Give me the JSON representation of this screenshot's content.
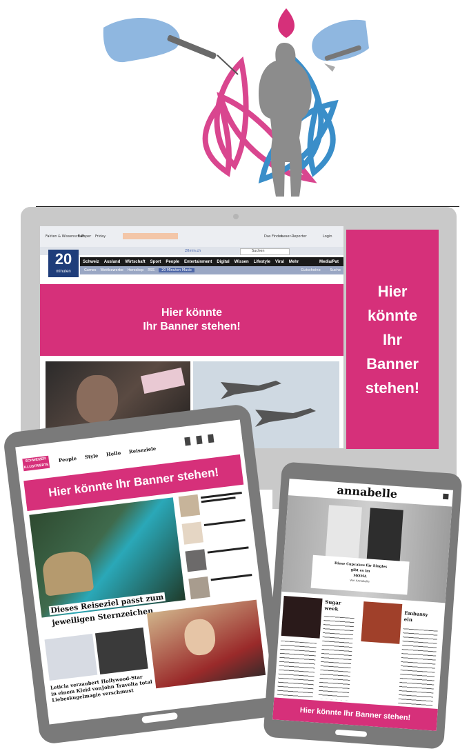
{
  "colors": {
    "accent": "#d6307a",
    "device_frame": "#7a7a7a",
    "monitor_frame": "#c9c9c9",
    "glove": "#8fb7e0",
    "lotus_pink": "#d9468f",
    "lotus_blue": "#3a8ec9",
    "silhouette": "#8c8c8c"
  },
  "monitor": {
    "site_logo": "20",
    "site_logo_sub": "minuten",
    "toplinks": [
      "Fakten & Wissenschaft",
      "E-Paper",
      "Friday"
    ],
    "toplinks_right": [
      "Das Finden",
      "Leser-Reporter",
      "Login"
    ],
    "url": "20min.ch",
    "search_placeholder": "Suchen",
    "nav_items": [
      "Schweiz",
      "Ausland",
      "Wirtschaft",
      "Sport",
      "People",
      "Entertainment",
      "Digital",
      "Wissen",
      "Lifestyle",
      "Viral",
      "Mehr"
    ],
    "nav_right": "Media/Pat",
    "subnav_items": [
      "Games",
      "Wettbewerbe",
      "Horoskop",
      "RSS",
      "20 Minuten Music"
    ],
    "subnav_right": [
      "Gutscheine",
      "Suche"
    ],
    "banner_line1": "Hier könnte",
    "banner_line2": "Ihr Banner stehen!",
    "skyscraper_lines": [
      "Hier",
      "könnte",
      "Ihr",
      "Banner",
      "stehen!"
    ]
  },
  "tablet": {
    "brand_line1": "SCHWEIZER",
    "brand_line2": "ILLUSTRIERTE",
    "nav_items": [
      "People",
      "Style",
      "Hello",
      "Reiseziele"
    ],
    "banner": "Hier könnte Ihr Banner stehen!",
    "headline_line1": "Dieses Reiseziel passt zum",
    "headline_line2": "jeweiligen Sternzeichen",
    "story1_line1": "Leticia verzaubert",
    "story1_line2": "in einem Kleid von",
    "story1_line3": "Liebeskugelmagie",
    "story2_line1": "Hollywood-Star",
    "story2_line2": "John Travolta total",
    "story2_line3": "verschmust"
  },
  "phone": {
    "brand": "annabelle",
    "card_line1": "Diese Cupcakes für Singles",
    "card_line2": "gibt es im",
    "card_line3": "MOMA",
    "card_byline": "Von Annabelle",
    "side_title1": "Sugar",
    "side_title1b": "week",
    "side_title2": "Embassy",
    "side_title2b": "ein",
    "banner": "Hier könnte Ihr Banner stehen!"
  }
}
